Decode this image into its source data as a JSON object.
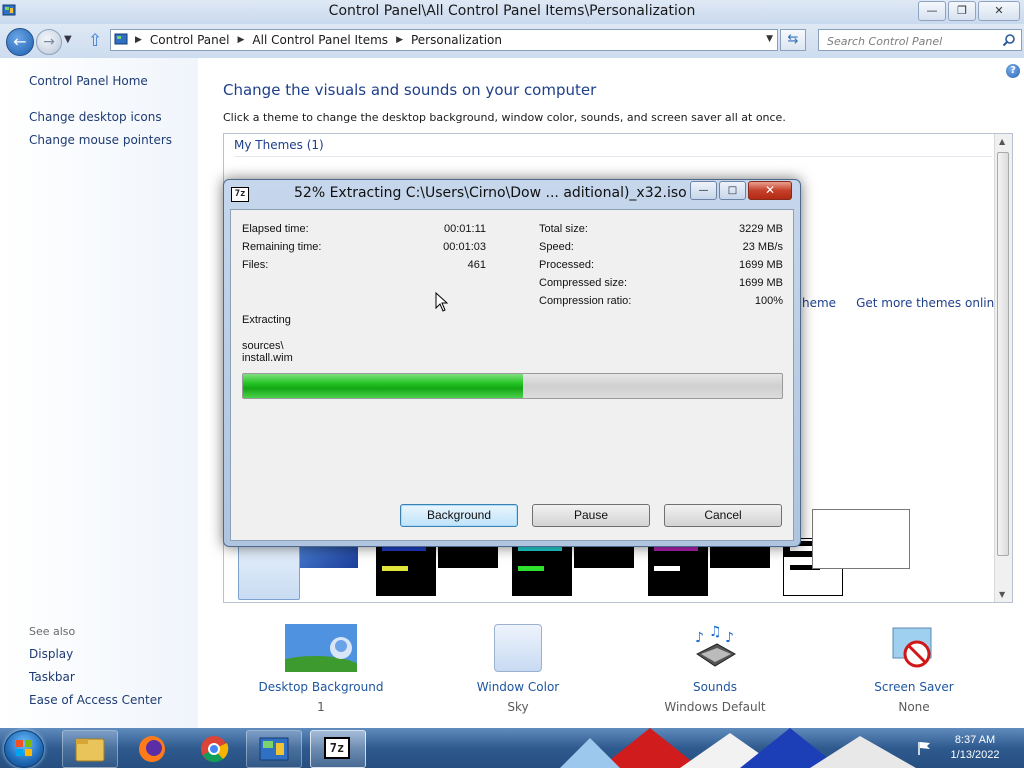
{
  "window": {
    "title": "Control Panel\\All Control Panel Items\\Personalization",
    "controls": {
      "minimize": "—",
      "maximize": "❐",
      "close": "✕"
    }
  },
  "address": {
    "breadcrumbs": [
      "Control Panel",
      "All Control Panel Items",
      "Personalization"
    ],
    "search_placeholder": "Search Control Panel"
  },
  "sidebar": {
    "home": "Control Panel Home",
    "links": [
      "Change desktop icons",
      "Change mouse pointers"
    ],
    "see_also_heading": "See also",
    "see_also": [
      "Display",
      "Taskbar",
      "Ease of Access Center"
    ]
  },
  "main": {
    "heading": "Change the visuals and sounds on your computer",
    "description": "Click a theme to change the desktop background, window color, sounds, and screen saver all at once.",
    "my_themes_label": "My Themes (1)",
    "links": [
      "heme",
      "Get more themes online"
    ]
  },
  "bottom_items": [
    {
      "label": "Desktop Background",
      "sub": "1"
    },
    {
      "label": "Window Color",
      "sub": "Sky"
    },
    {
      "label": "Sounds",
      "sub": "Windows Default"
    },
    {
      "label": "Screen Saver",
      "sub": "None"
    }
  ],
  "dialog": {
    "icon_text": "7z",
    "title": "52% Extracting C:\\Users\\Cirno\\Dow ... aditional)_x32.iso",
    "left_stats": [
      {
        "label": "Elapsed time:",
        "value": "00:01:11"
      },
      {
        "label": "Remaining time:",
        "value": "00:01:03"
      },
      {
        "label": "Files:",
        "value": "461"
      }
    ],
    "right_stats": [
      {
        "label": "Total size:",
        "value": "3229 MB"
      },
      {
        "label": "Speed:",
        "value": "23 MB/s"
      },
      {
        "label": "Processed:",
        "value": "1699 MB"
      },
      {
        "label": "Compressed size:",
        "value": "1699 MB"
      },
      {
        "label": "Compression ratio:",
        "value": "100%"
      }
    ],
    "extracting_label": "Extracting",
    "current_path": [
      "sources\\",
      "install.wim"
    ],
    "progress_fraction": 0.52,
    "buttons": {
      "background": "Background",
      "pause": "Pause",
      "cancel": "Cancel"
    }
  },
  "taskbar": {
    "apps": [
      "explorer",
      "firefox",
      "chrome",
      "control-panel",
      "7-zip"
    ],
    "app_7zip_label": "7z",
    "time": "8:37 AM",
    "date": "1/13/2022"
  },
  "colors": {
    "link": "#1e3f8a",
    "progress_green": "#22c322",
    "taskbar_blue": "#2e5a8f"
  }
}
